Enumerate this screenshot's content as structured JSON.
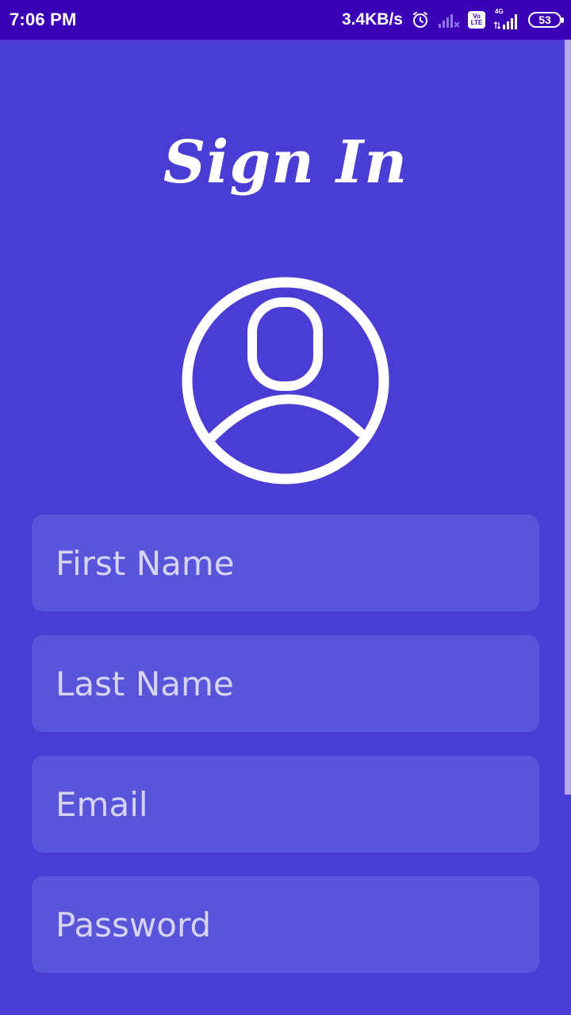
{
  "status_bar": {
    "time": "7:06 PM",
    "net_speed": "3.4KB/s",
    "volte_top": "Vo",
    "volte_bottom": "LTE",
    "network_type": "4G",
    "battery": "53",
    "icons": [
      "alarm-icon",
      "signal-off-icon",
      "volte-icon",
      "signal-4g-icon",
      "battery-icon"
    ]
  },
  "header": {
    "title": "Sign In"
  },
  "avatar": {
    "icon": "user-circle-icon"
  },
  "form": {
    "first_name": {
      "placeholder": "First Name",
      "value": ""
    },
    "last_name": {
      "placeholder": "Last Name",
      "value": ""
    },
    "email": {
      "placeholder": "Email",
      "value": ""
    },
    "password": {
      "placeholder": "Password",
      "value": ""
    }
  },
  "colors": {
    "background": "#4a3dd3",
    "status_bar": "#3b00b6",
    "field_background": "#5955da",
    "placeholder": "#d6d3f3",
    "scroll_indicator": "#b7a7ef"
  }
}
